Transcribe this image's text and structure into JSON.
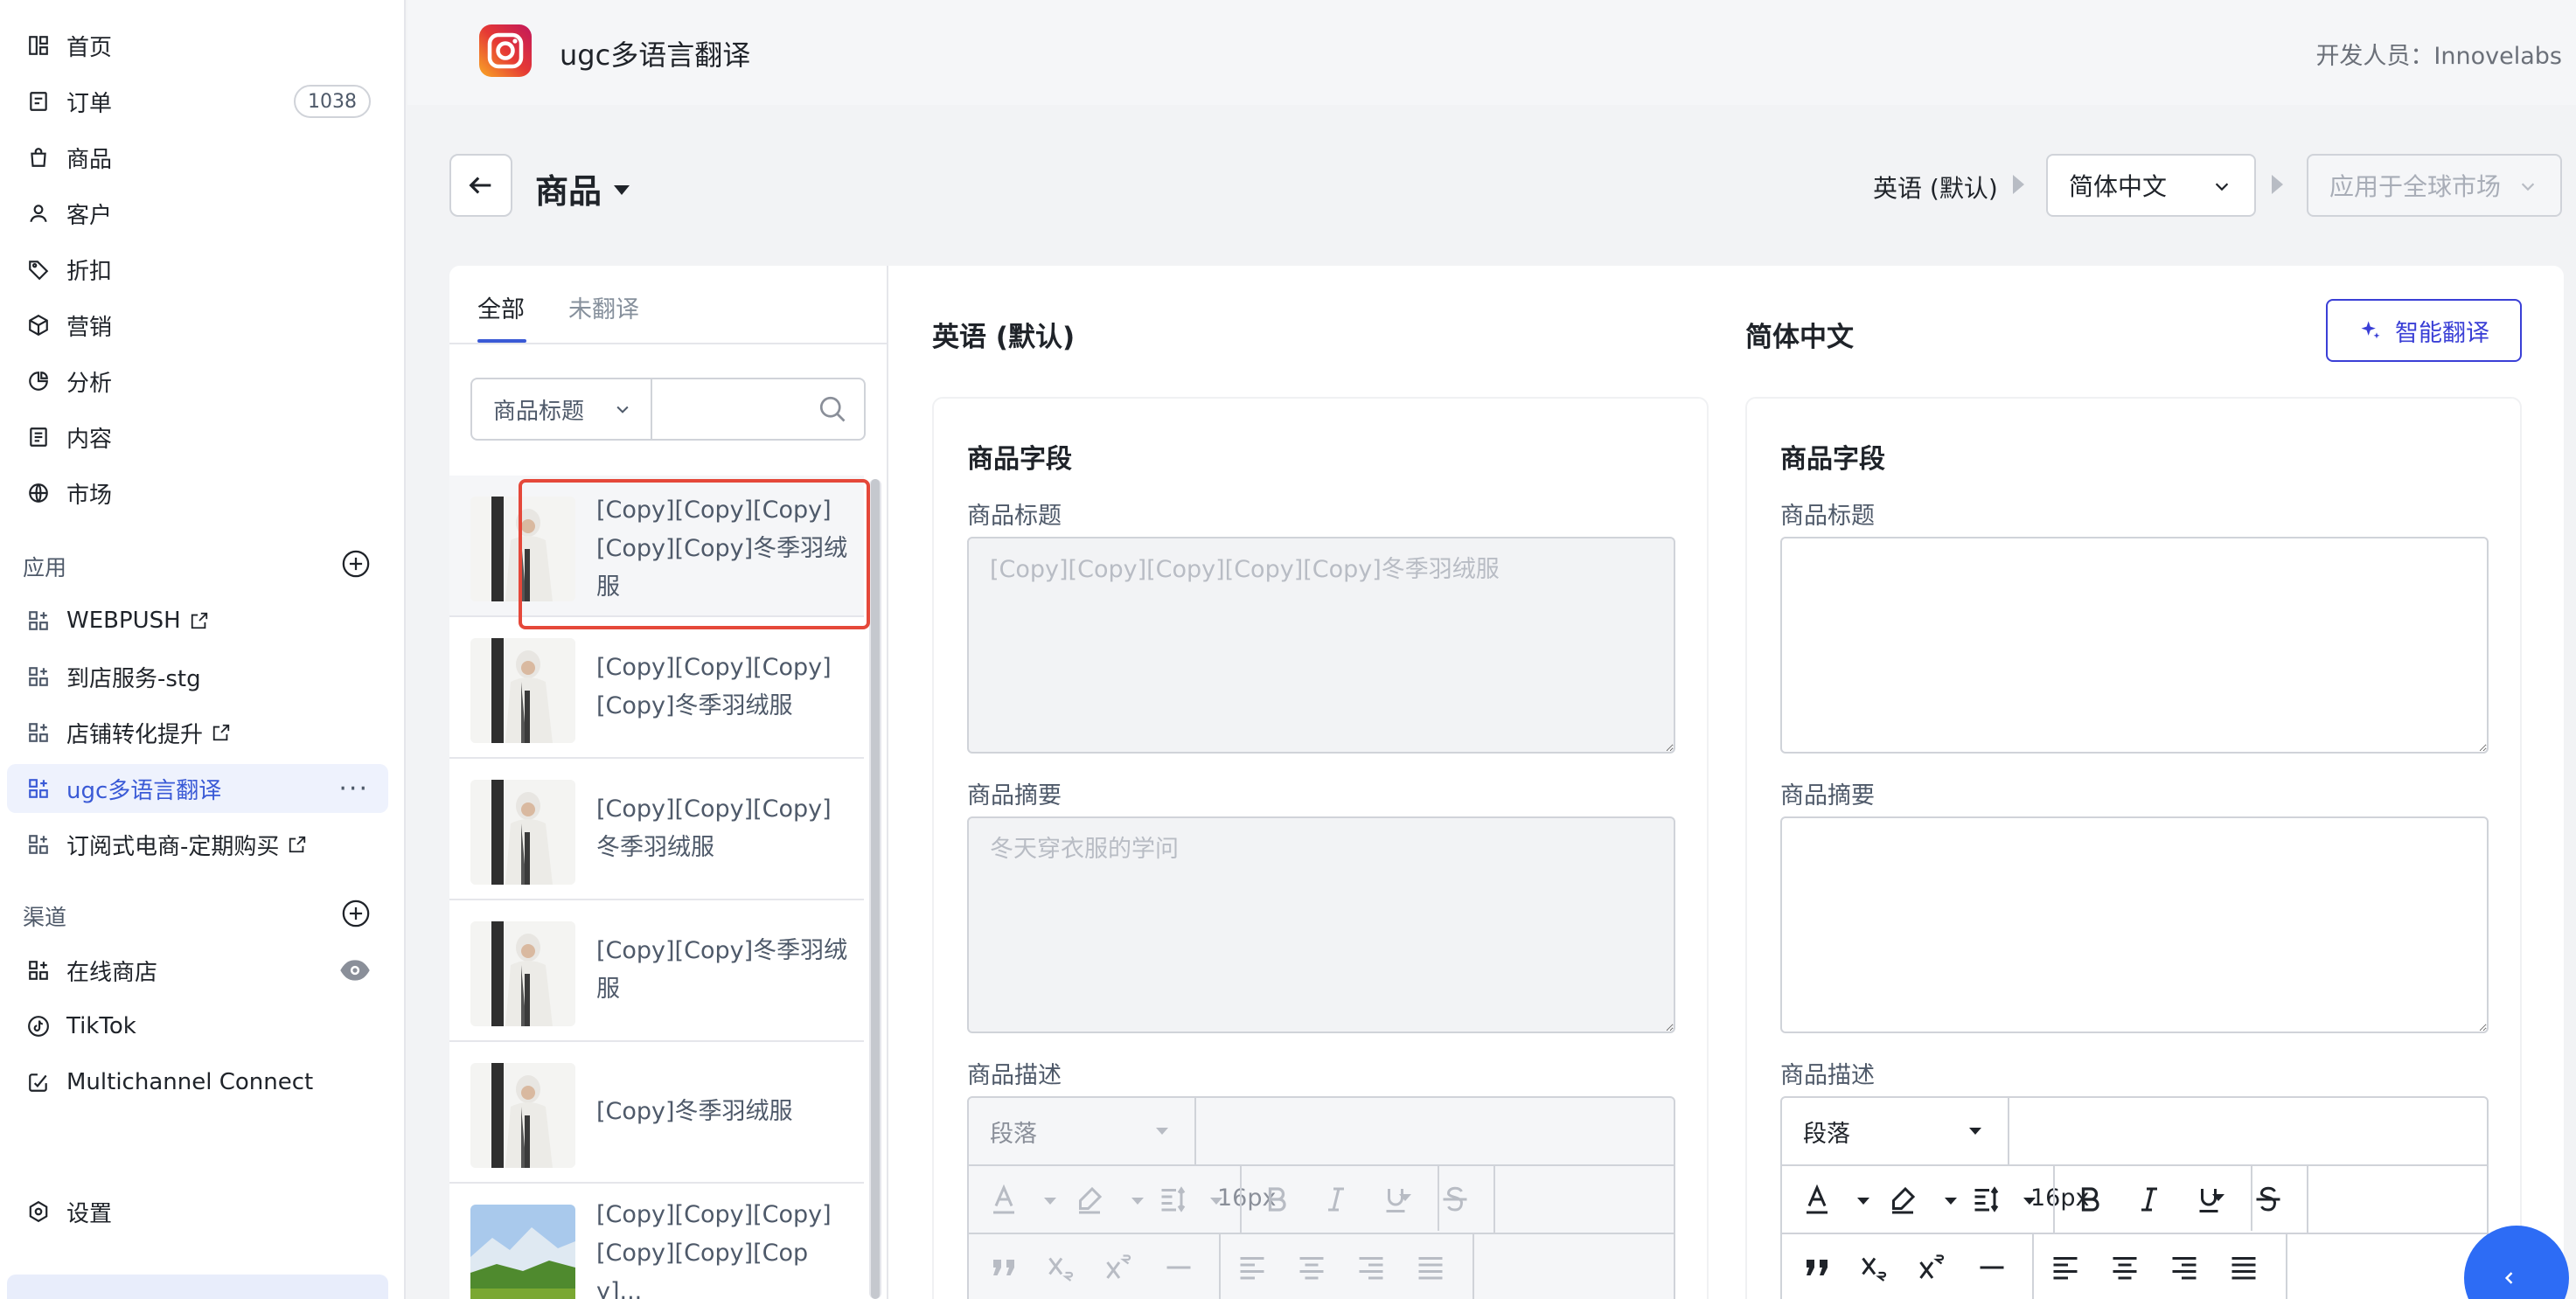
{
  "sidebar": {
    "nav": [
      {
        "label": "首页",
        "icon": "home-icon"
      },
      {
        "label": "订单",
        "icon": "order-icon",
        "badge": "1038"
      },
      {
        "label": "商品",
        "icon": "product-bag-icon"
      },
      {
        "label": "客户",
        "icon": "customer-icon"
      },
      {
        "label": "折扣",
        "icon": "tag-icon"
      },
      {
        "label": "营销",
        "icon": "cube-icon"
      },
      {
        "label": "分析",
        "icon": "pie-chart-icon"
      },
      {
        "label": "内容",
        "icon": "document-icon"
      },
      {
        "label": "市场",
        "icon": "globe-icon"
      }
    ],
    "apps_title": "应用",
    "apps": [
      {
        "label": "WEBPUSH",
        "external": true
      },
      {
        "label": "到店服务-stg",
        "external": false
      },
      {
        "label": "店铺转化提升",
        "external": true
      },
      {
        "label": "ugc多语言翻译",
        "external": false,
        "active": true
      },
      {
        "label": "订阅式电商-定期购买",
        "external": true
      }
    ],
    "channels_title": "渠道",
    "channels": [
      {
        "label": "在线商店",
        "icon": "store-icon"
      },
      {
        "label": "TikTok",
        "icon": "tiktok-icon"
      },
      {
        "label": "Multichannel Connect",
        "icon": "multichannel-icon"
      }
    ],
    "settings_label": "设置",
    "more_label": "···"
  },
  "header": {
    "app_title": "ugc多语言翻译",
    "developer": "开发人员：Innovelabs"
  },
  "subheader": {
    "title": "商品",
    "source_lang": "英语 (默认)",
    "target_lang": "简体中文",
    "apply_market": "应用于全球市场"
  },
  "list": {
    "tabs": [
      "全部",
      "未翻译"
    ],
    "filter_field": "商品标题",
    "search_value": "",
    "items": [
      "[Copy][Copy][Copy][Copy][Copy]冬季羽绒服",
      "[Copy][Copy][Copy][Copy]冬季羽绒服",
      "[Copy][Copy][Copy]冬季羽绒服",
      "[Copy][Copy]冬季羽绒服",
      "[Copy]冬季羽绒服",
      "[Copy][Copy][Copy][Copy][Copy][Copy]..."
    ]
  },
  "source": {
    "header": "英语 (默认)",
    "section_title": "商品字段",
    "title_label": "商品标题",
    "title_value": "[Copy][Copy][Copy][Copy][Copy]冬季羽绒服",
    "summary_label": "商品摘要",
    "summary_value": "冬天穿衣服的学问",
    "desc_label": "商品描述",
    "paragraph": "段落",
    "font_size": "16px"
  },
  "target": {
    "header": "简体中文",
    "ai_translate": "智能翻译",
    "section_title": "商品字段",
    "title_label": "商品标题",
    "title_value": "",
    "summary_label": "商品摘要",
    "summary_value": "",
    "desc_label": "商品描述",
    "paragraph": "段落",
    "font_size": "16px"
  },
  "colors": {
    "accent": "#3a5ad6",
    "ai_button": "#3a3fd6",
    "highlight": "#e5483a",
    "fab": "#2d6cf5"
  }
}
